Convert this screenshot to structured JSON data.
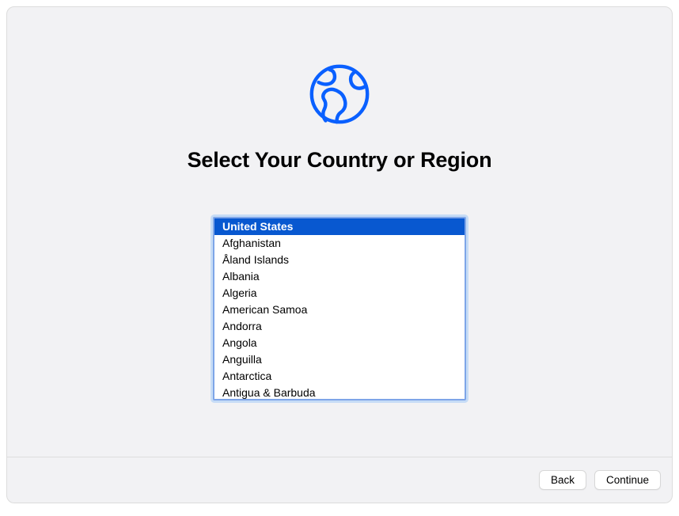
{
  "icon": {
    "name": "globe-icon",
    "color": "#0a60ff"
  },
  "title": "Select Your Country or Region",
  "countries": {
    "selected_index": 0,
    "items": [
      "United States",
      "Afghanistan",
      "Åland Islands",
      "Albania",
      "Algeria",
      "American Samoa",
      "Andorra",
      "Angola",
      "Anguilla",
      "Antarctica",
      "Antigua & Barbuda"
    ]
  },
  "buttons": {
    "back": "Back",
    "continue": "Continue"
  }
}
